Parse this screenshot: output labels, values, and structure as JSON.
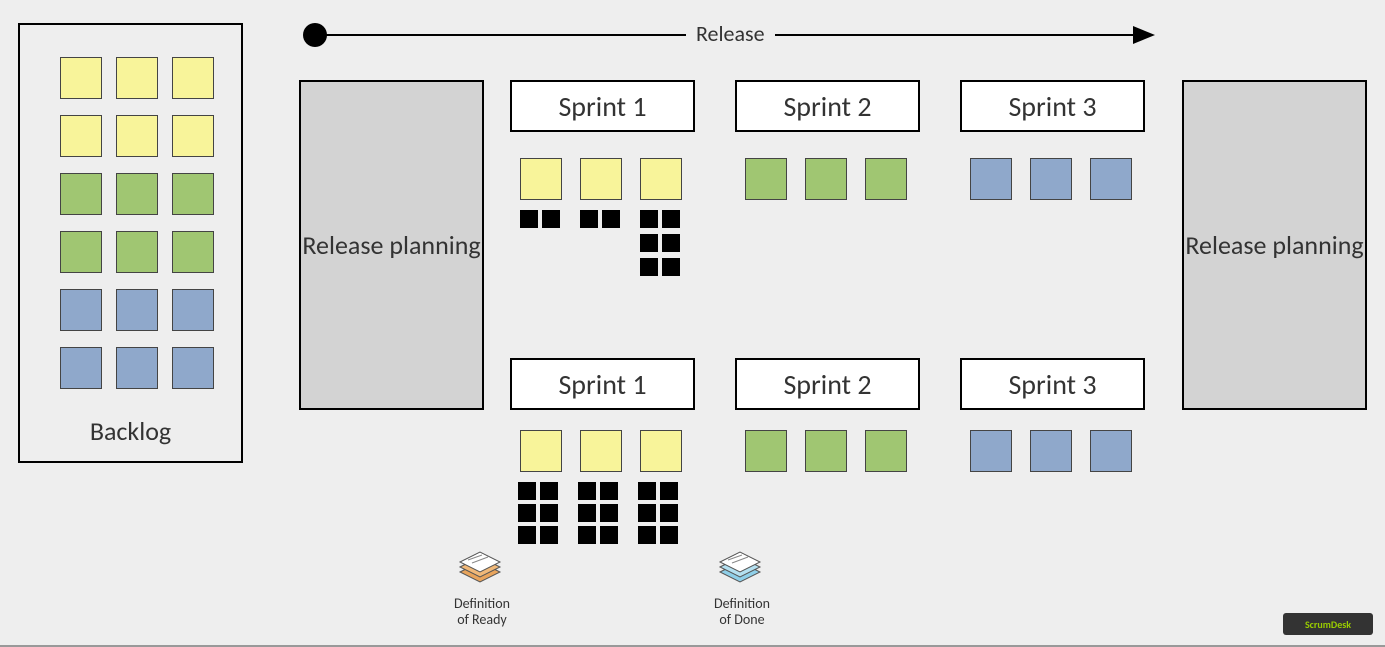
{
  "release_label": "Release",
  "backlog": {
    "title": "Backlog"
  },
  "planning_left": "Release planning",
  "planning_right": "Release planning",
  "sprints_row1": [
    "Sprint 1",
    "Sprint 2",
    "Sprint 3"
  ],
  "sprints_row2": [
    "Sprint 1",
    "Sprint 2",
    "Sprint 3"
  ],
  "definition_ready": "Definition\nof Ready",
  "definition_done": "Definition\nof Done",
  "logo": "ScrumDesk",
  "colors": {
    "yellow": "#f8f49a",
    "green": "#a0c672",
    "blue": "#8fa8cb",
    "task": "#000000"
  }
}
